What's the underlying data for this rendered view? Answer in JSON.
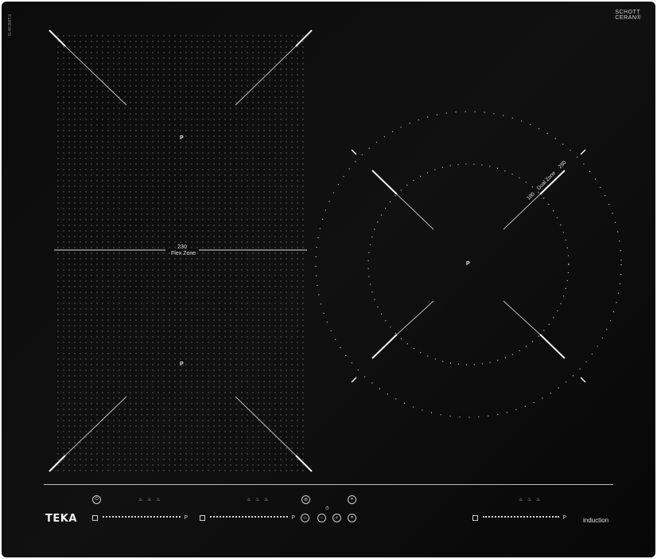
{
  "brand": {
    "schott_line1": "SCHOTT",
    "schott_line2": "CERAN®",
    "serial": "SI.4R.BHT.9"
  },
  "flex_zone": {
    "size": "230",
    "label": "Flex Zone"
  },
  "dual_zone": {
    "inner": "180",
    "label": "Dual Zone",
    "outer": "280"
  },
  "power_mark": "P",
  "panel": {
    "logo": "TEKA",
    "tagline": "induction",
    "sliders": [
      {
        "end_label": "P"
      },
      {
        "end_label": "P"
      },
      {
        "end_label": "P"
      }
    ],
    "functions": {
      "triplet": "♨ ♨ ♨"
    },
    "buttons": {
      "power": "⏻",
      "lock": "⊚",
      "pause": "⏸",
      "minus": "−",
      "plus": "+",
      "timer": "⏱",
      "keep_warm": "♨"
    }
  },
  "colors": {
    "surface": "#0b0b0b",
    "marks": "#e0e0e0"
  }
}
